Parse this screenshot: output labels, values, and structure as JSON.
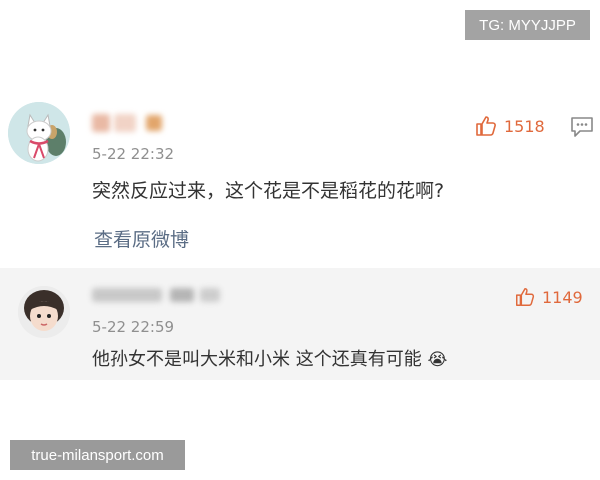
{
  "badge": {
    "text": "TG: MYYJJPP"
  },
  "comments": [
    {
      "timestamp": "5-22 22:32",
      "text": "突然反应过来，这个花是不是稻花的花啊?",
      "likes": "1518",
      "view_original": "查看原微博",
      "avatar_icon": "cat-avatar-icon"
    },
    {
      "timestamp": "5-22 22:59",
      "text": "他孙女不是叫大米和小米 这个还真有可能",
      "emoji": "😭",
      "likes": "1149",
      "avatar_icon": "child-avatar-icon"
    }
  ],
  "watermark": {
    "text": "true-milansport.com"
  },
  "colors": {
    "accent": "#e0693c",
    "link": "#5b6d85",
    "muted": "#8f8f8f"
  }
}
